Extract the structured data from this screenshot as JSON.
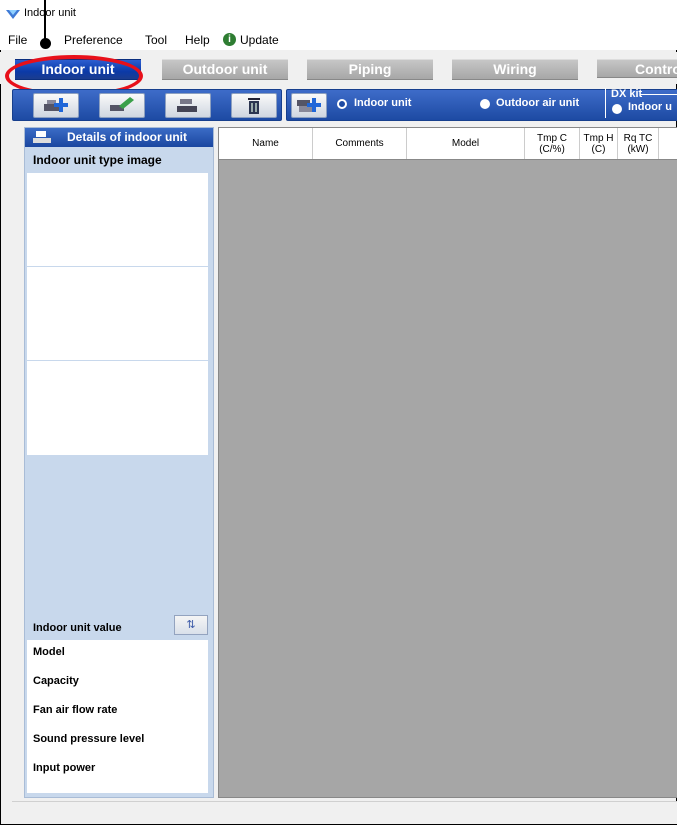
{
  "window": {
    "title": "Indoor unit"
  },
  "menu": {
    "items": [
      "File",
      "Preference",
      "Tool",
      "Help"
    ],
    "update_label": "Update",
    "update_icon": "info-icon"
  },
  "tabs": [
    {
      "label": "Indoor unit",
      "active": true
    },
    {
      "label": "Outdoor unit",
      "active": false
    },
    {
      "label": "Piping",
      "active": false
    },
    {
      "label": "Wiring",
      "active": false
    },
    {
      "label": "Contro",
      "active": false
    }
  ],
  "toolbar": {
    "buttons": [
      "add-unit-icon",
      "edit-unit-icon",
      "copy-unit-icon",
      "delete-icon"
    ],
    "add_dx_icon": "add-dx-icon",
    "radio_indoor": "Indoor unit",
    "radio_outdoor_air": "Outdoor air unit",
    "dx_kit_label": "DX kit",
    "dx_indoor_partial": "Indoor u"
  },
  "left_panel": {
    "header": "Details of indoor unit",
    "image_title": "Indoor unit type image",
    "value_title": "Indoor unit value",
    "value_rows": [
      "Model",
      "Capacity",
      "Fan air flow rate",
      "Sound pressure level",
      "Input power"
    ]
  },
  "grid": {
    "columns": [
      {
        "label": "Name"
      },
      {
        "label": "Comments"
      },
      {
        "label": "Model"
      },
      {
        "label": "Tmp C\n(C/%)"
      },
      {
        "label": "Tmp H\n(C)"
      },
      {
        "label": "Rq TC\n(kW)"
      }
    ]
  },
  "colors": {
    "accent": "#1a46a0",
    "callout": "#e8101a"
  }
}
